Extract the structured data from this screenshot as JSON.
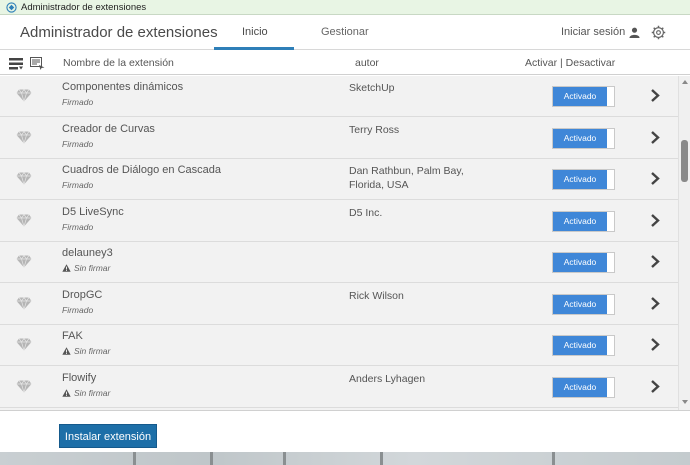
{
  "window": {
    "title": "Administrador de extensiones"
  },
  "header": {
    "app_name": "Administrador de extensiones",
    "tabs": [
      {
        "label": "Inicio",
        "active": true
      },
      {
        "label": "Gestionar",
        "active": false
      }
    ],
    "signin_label": "Iniciar sesión",
    "settings_icon": "gear-icon"
  },
  "columns": {
    "name": "Nombre de la extensión",
    "author": "autor",
    "toggle": "Activar | Desactivar"
  },
  "extensions": [
    {
      "name": "Componentes dinámicos",
      "status": "Firmado",
      "signed": true,
      "author": "SketchUp",
      "state": "Activado"
    },
    {
      "name": "Creador de Curvas",
      "status": "Firmado",
      "signed": true,
      "author": "Terry Ross",
      "state": "Activado"
    },
    {
      "name": "Cuadros de Diálogo en Cascada",
      "status": "Firmado",
      "signed": true,
      "author": "Dan Rathbun, Palm Bay, Florida, USA",
      "state": "Activado"
    },
    {
      "name": "D5 LiveSync",
      "status": "Firmado",
      "signed": true,
      "author": "D5 Inc.",
      "state": "Activado"
    },
    {
      "name": "delauney3",
      "status": "Sin firmar",
      "signed": false,
      "author": "",
      "state": "Activado"
    },
    {
      "name": "DropGC",
      "status": "Firmado",
      "signed": true,
      "author": "Rick Wilson",
      "state": "Activado"
    },
    {
      "name": "FAK",
      "status": "Sin firmar",
      "signed": false,
      "author": "",
      "state": "Activado"
    },
    {
      "name": "Flowify",
      "status": "Sin firmar",
      "signed": false,
      "author": "Anders Lyhagen",
      "state": "Activado"
    }
  ],
  "footer": {
    "install_label": "Instalar extensión"
  },
  "colors": {
    "accent": "#2e7fb8",
    "toggle_on": "#3f87d8",
    "install_button": "#1d6fa8",
    "titlebar": "#e8f5e4"
  }
}
